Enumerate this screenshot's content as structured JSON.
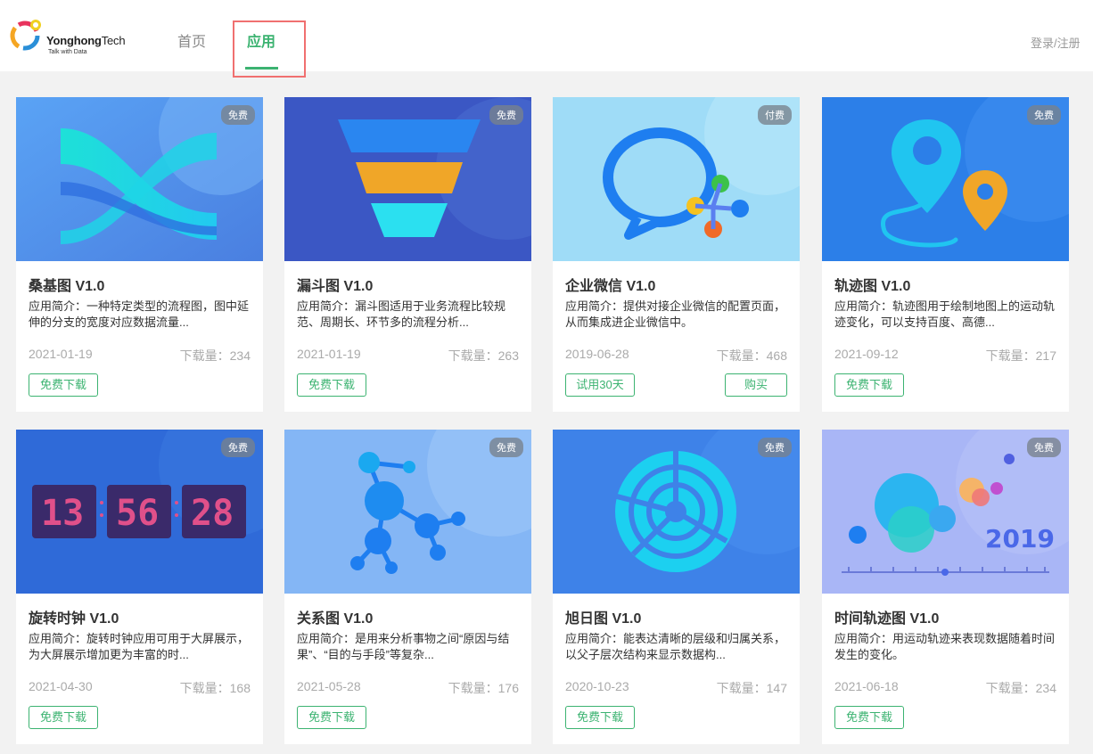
{
  "brand": {
    "name_bold": "Yonghong",
    "name_thin": "Tech",
    "tagline": "Talk with Data"
  },
  "nav": {
    "home": "首页",
    "apps": "应用",
    "login": "登录/注册"
  },
  "colors": {
    "accent": "#3cb371",
    "highlight_border": "#f07070"
  },
  "cards": [
    {
      "badge": "免费",
      "title": "桑基图 V1.0",
      "desc": "应用简介：一种特定类型的流程图，图中延伸的分支的宽度对应数据流量...",
      "date": "2021-01-19",
      "downloads": "下载量：234",
      "btn1": "免费下载",
      "btn2": "",
      "icon": "sankey-chart-icon"
    },
    {
      "badge": "免费",
      "title": "漏斗图 V1.0",
      "desc": "应用简介：漏斗图适用于业务流程比较规范、周期长、环节多的流程分析...",
      "date": "2021-01-19",
      "downloads": "下载量：263",
      "btn1": "免费下载",
      "btn2": "",
      "icon": "funnel-chart-icon"
    },
    {
      "badge": "付费",
      "title": "企业微信 V1.0",
      "desc": "应用简介：提供对接企业微信的配置页面，从而集成进企业微信中。",
      "date": "2019-06-28",
      "downloads": "下载量：468",
      "btn1": "试用30天",
      "btn2": "购买",
      "icon": "wechat-work-icon"
    },
    {
      "badge": "免费",
      "title": "轨迹图 V1.0",
      "desc": "应用简介：轨迹图用于绘制地图上的运动轨迹变化，可以支持百度、高德...",
      "date": "2021-09-12",
      "downloads": "下载量：217",
      "btn1": "免费下载",
      "btn2": "",
      "icon": "map-pin-track-icon"
    },
    {
      "badge": "免费",
      "title": "旋转时钟 V1.0",
      "desc": "应用简介：旋转时钟应用可用于大屏展示，为大屏展示增加更为丰富的时...",
      "date": "2021-04-30",
      "downloads": "下载量：168",
      "btn1": "免费下载",
      "btn2": "",
      "icon": "digital-clock-icon",
      "clock": [
        "13",
        "56",
        "28"
      ]
    },
    {
      "badge": "免费",
      "title": "关系图 V1.0",
      "desc": "应用简介：是用来分析事物之间“原因与结果”、“目的与手段”等复杂...",
      "date": "2021-05-28",
      "downloads": "下载量：176",
      "btn1": "免费下载",
      "btn2": "",
      "icon": "relation-graph-icon"
    },
    {
      "badge": "免费",
      "title": "旭日图 V1.0",
      "desc": "应用简介：能表达清晰的层级和归属关系，以父子层次结构来显示数据构...",
      "date": "2020-10-23",
      "downloads": "下载量：147",
      "btn1": "免费下载",
      "btn2": "",
      "icon": "sunburst-chart-icon"
    },
    {
      "badge": "免费",
      "title": "时间轨迹图 V1.0",
      "desc": "应用简介：用运动轨迹来表现数据随着时间发生的变化。",
      "date": "2021-06-18",
      "downloads": "下载量：234",
      "btn1": "免费下载",
      "btn2": "",
      "icon": "timeline-track-icon",
      "year": "2019"
    }
  ]
}
